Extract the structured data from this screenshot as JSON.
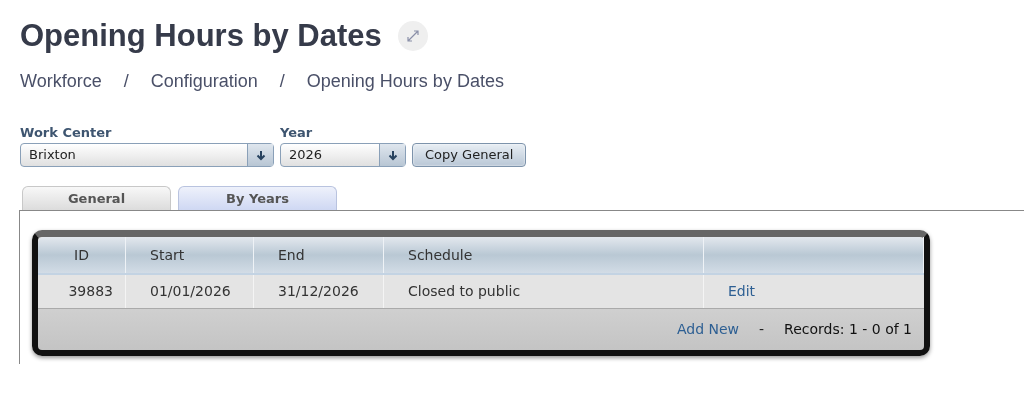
{
  "title": "Opening Hours by Dates",
  "breadcrumb": [
    {
      "label": "Workforce"
    },
    {
      "label": "Configuration"
    },
    {
      "label": "Opening Hours by Dates"
    }
  ],
  "breadcrumb_separator": "/",
  "filters": [
    {
      "label": "Work Center",
      "value": "Brixton"
    },
    {
      "label": "Year",
      "value": "2026"
    }
  ],
  "copy_button": "Copy General",
  "tabs": [
    {
      "label": "General",
      "selected": false
    },
    {
      "label": "By Years",
      "selected": true
    }
  ],
  "table": {
    "columns": [
      "ID",
      "Start",
      "End",
      "Schedule",
      ""
    ],
    "rows": [
      {
        "id": "39883",
        "start": "01/01/2026",
        "end": "31/12/2026",
        "schedule": "Closed to public",
        "action": "Edit"
      }
    ],
    "footer": {
      "add_new": "Add New",
      "separator": "-",
      "records": "Records: 1 - 0 of 1"
    }
  }
}
